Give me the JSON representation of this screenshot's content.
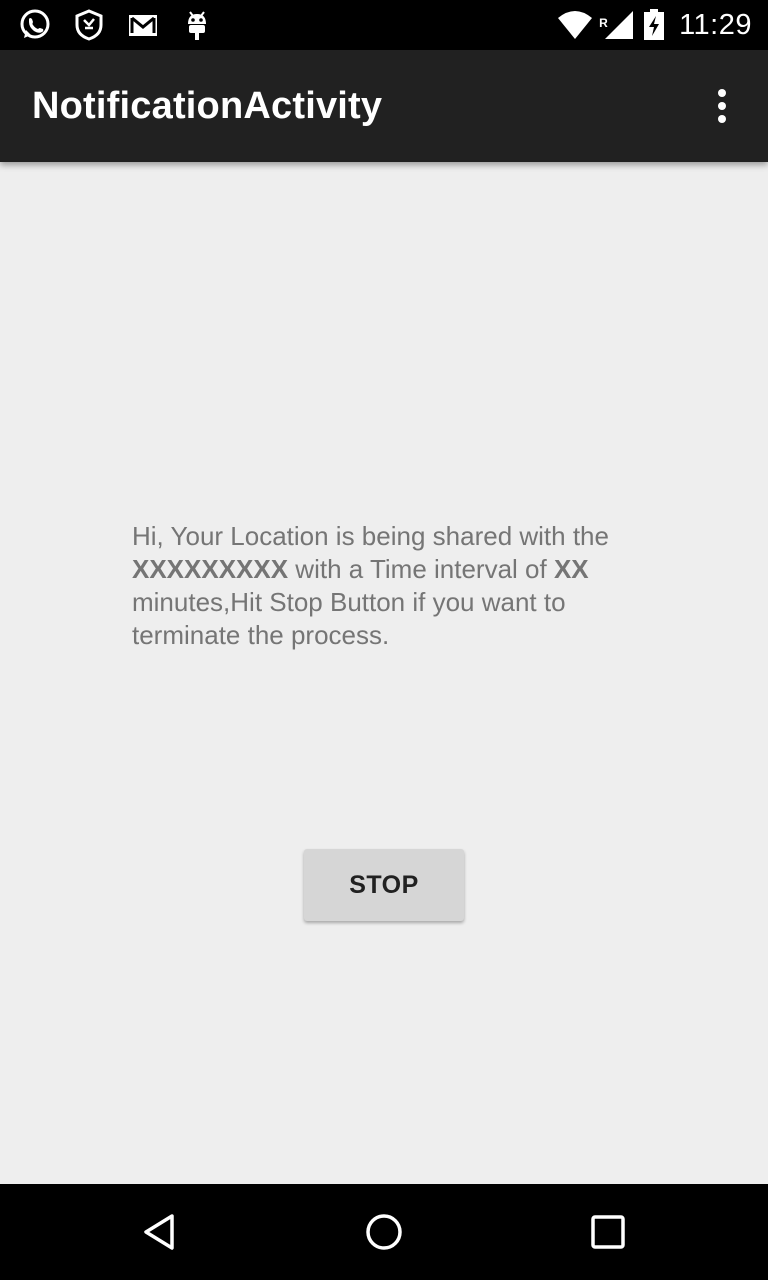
{
  "status_bar": {
    "time": "11:29",
    "roaming_indicator": "R",
    "left_icons": [
      "whatsapp-icon",
      "shield-icon",
      "gmail-icon",
      "android-debug-icon"
    ],
    "right_icons": [
      "wifi-icon",
      "signal-icon",
      "battery-charging-icon"
    ]
  },
  "app_bar": {
    "title": "NotificationActivity",
    "menu_icon": "overflow-menu-icon"
  },
  "message": {
    "part1": "Hi, Your Location is being shared with the ",
    "recipient": "XXXXXXXXX",
    "part2": " with a Time interval of ",
    "interval": "XX",
    "part3": " minutes,Hit Stop Button if you want to terminate the process."
  },
  "stop_button": {
    "label": "STOP"
  },
  "nav_bar": {
    "icons": [
      "back-icon",
      "home-icon",
      "recents-icon"
    ]
  },
  "colors": {
    "status_bar": "#000000",
    "app_bar": "#212121",
    "background": "#eeeeee",
    "message_text": "#757575",
    "button": "#d6d6d6"
  }
}
